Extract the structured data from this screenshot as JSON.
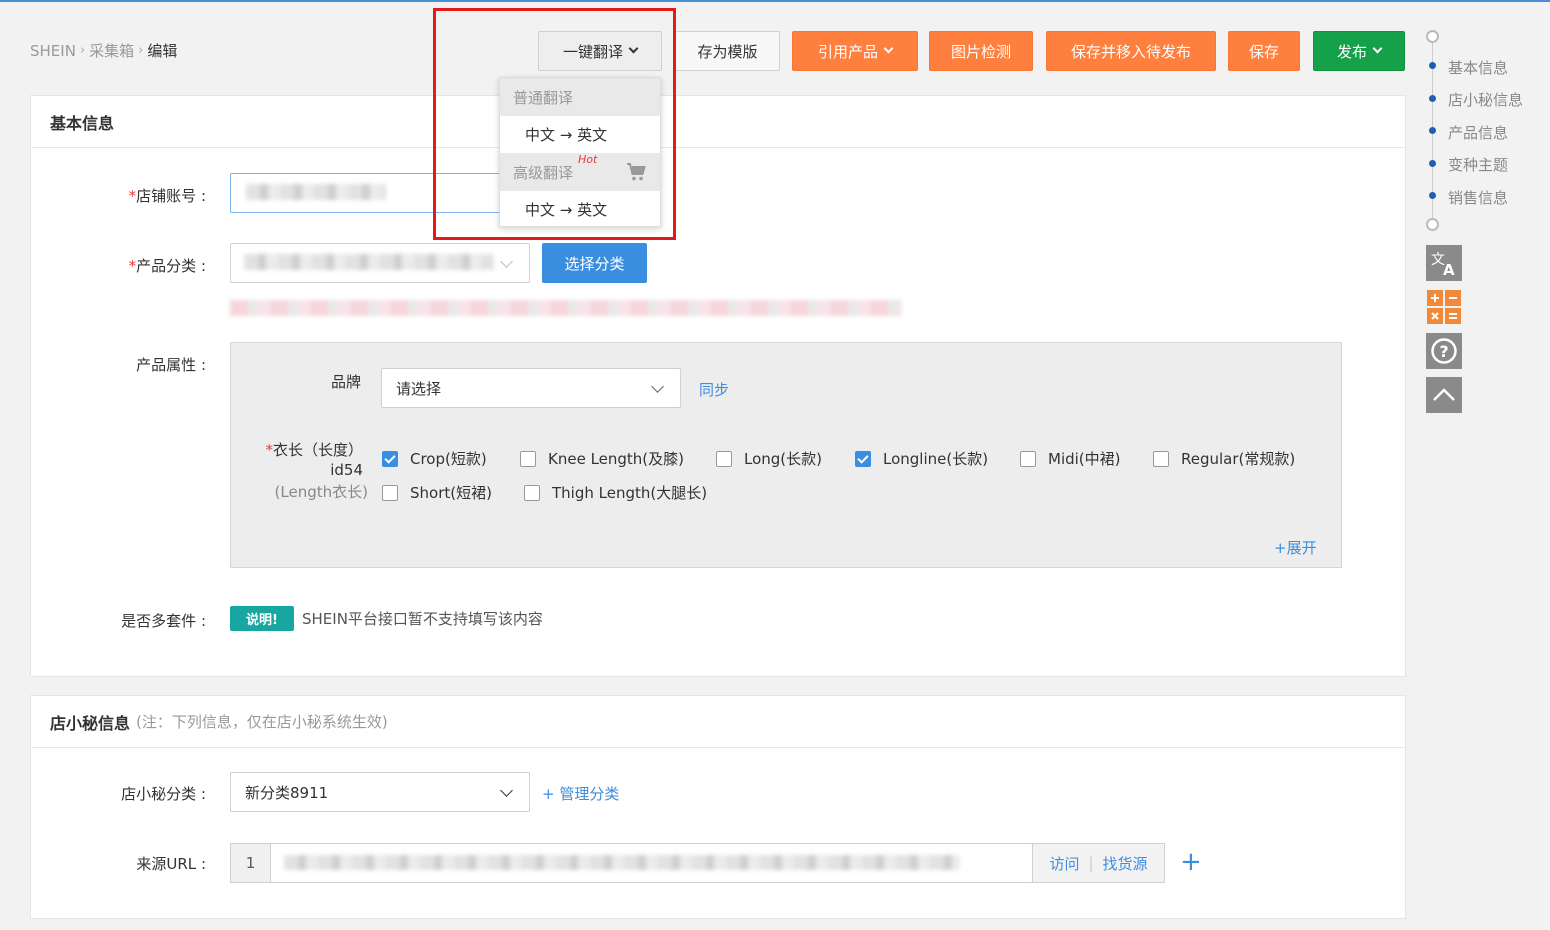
{
  "breadcrumb": {
    "root": "SHEIN",
    "level1": "采集箱",
    "current": "编辑"
  },
  "toolbar": {
    "translate": "一键翻译",
    "save_template": "存为模版",
    "quote_product": "引用产品",
    "image_check": "图片检测",
    "save_move": "保存并移入待发布",
    "save": "保存",
    "publish": "发布"
  },
  "translate_menu": {
    "group_normal": "普通翻译",
    "item_normal": "中文 → 英文",
    "group_advanced": "高级翻译",
    "hot": "Hot",
    "item_advanced": "中文 → 英文"
  },
  "basic_info": {
    "title": "基本信息",
    "store_account_label": "店铺账号",
    "category_label": "产品分类",
    "select_category_btn": "选择分类",
    "attributes_label": "产品属性",
    "brand_label": "品牌",
    "brand_placeholder": "请选择",
    "sync_link": "同步",
    "length_label_1": "衣长（长度）",
    "length_label_2": "id54",
    "length_label_3": "(Length衣长)",
    "length_options": [
      {
        "label": "Crop(短款)",
        "checked": true
      },
      {
        "label": "Knee Length(及膝)",
        "checked": false
      },
      {
        "label": "Long(长款)",
        "checked": false
      },
      {
        "label": "Longline(长款)",
        "checked": true
      },
      {
        "label": "Midi(中裙)",
        "checked": false
      },
      {
        "label": "Regular(常规款)",
        "checked": false
      },
      {
        "label": "Short(短裙)",
        "checked": false
      },
      {
        "label": "Thigh Length(大腿长)",
        "checked": false
      }
    ],
    "expand_link": "+展开",
    "multi_set_label": "是否多套件",
    "notice_badge": "说明!",
    "notice_text": "SHEIN平台接口暂不支持填写该内容"
  },
  "dxm_info": {
    "title": "店小秘信息",
    "note": "(注：下列信息，仅在店小秘系统生效)",
    "category_label": "店小秘分类",
    "category_value": "新分类8911",
    "manage_link": "+ 管理分类",
    "source_url_label": "来源URL",
    "source_index": "1",
    "visit_btn": "访问",
    "find_source_btn": "找货源"
  },
  "side_nav": {
    "items": [
      "基本信息",
      "店小秘信息",
      "产品信息",
      "变种主题",
      "销售信息"
    ]
  },
  "colors": {
    "orange": "#ff7f3f",
    "green": "#15a14a",
    "blue": "#3a8ee0",
    "red_highlight": "#e61919"
  }
}
